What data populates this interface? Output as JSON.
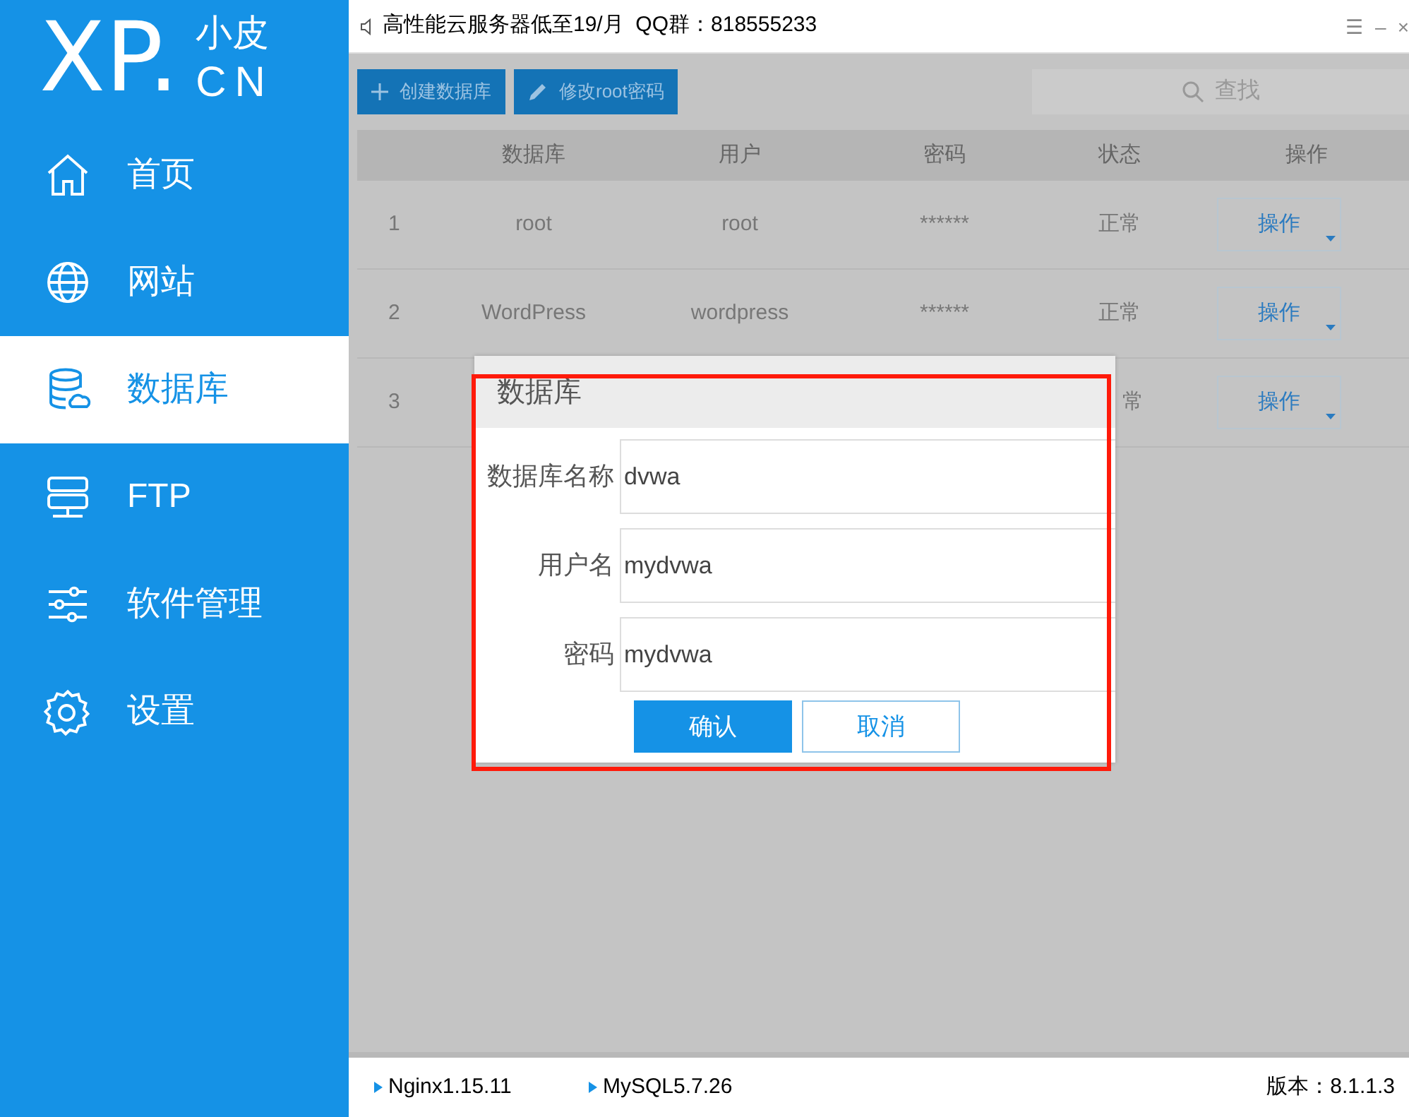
{
  "logo": {
    "main": "XP.",
    "top": "小皮",
    "bottom": "CN"
  },
  "sidebar": {
    "items": [
      {
        "label": "首页",
        "selected": false
      },
      {
        "label": "网站",
        "selected": false
      },
      {
        "label": "数据库",
        "selected": true
      },
      {
        "label": "FTP",
        "selected": false
      },
      {
        "label": "软件管理",
        "selected": false
      },
      {
        "label": "设置",
        "selected": false
      }
    ]
  },
  "top_bar": {
    "notice": "高性能云服务器低至19/月  QQ群：818555233",
    "controls": [
      "☰",
      "–",
      "×"
    ]
  },
  "toolbar": {
    "buttons": [
      {
        "label": "创建数据库"
      },
      {
        "label": "修改root密码"
      }
    ],
    "search": {
      "placeholder": "查找"
    }
  },
  "table": {
    "columns": [
      "数据库",
      "用户",
      "密码",
      "状态",
      "操作"
    ],
    "rows": [
      {
        "index": "1",
        "database": "root",
        "user": "root",
        "password": "******",
        "status": "正常",
        "action": "操作"
      },
      {
        "index": "2",
        "database": "WordPress",
        "user": "wordpress",
        "password": "******",
        "status": "正常",
        "action": "操作"
      },
      {
        "index": "3",
        "status": "常",
        "action": "操作"
      }
    ]
  },
  "dialog": {
    "title": "数据库",
    "fields": [
      {
        "label": "数据库名称",
        "value": "dvwa"
      },
      {
        "label": "用户名",
        "value": "mydvwa"
      },
      {
        "label": "密码",
        "value": "mydvwa"
      }
    ],
    "buttons": [
      {
        "label": "确认",
        "kind": "primary"
      },
      {
        "label": "取消",
        "kind": "secondary"
      }
    ],
    "highlighted": true
  },
  "status_bar": {
    "services": [
      "Nginx1.15.11",
      "MySQL5.7.26"
    ],
    "version": "版本：8.1.1.3"
  }
}
